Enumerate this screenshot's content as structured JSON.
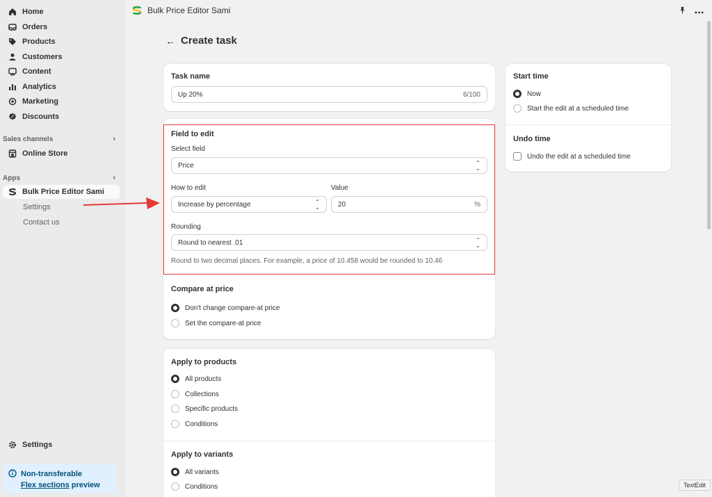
{
  "sidebar": {
    "items": [
      {
        "label": "Home",
        "icon": "home-icon"
      },
      {
        "label": "Orders",
        "icon": "inbox-icon"
      },
      {
        "label": "Products",
        "icon": "tag-icon"
      },
      {
        "label": "Customers",
        "icon": "person-icon"
      },
      {
        "label": "Content",
        "icon": "content-icon"
      },
      {
        "label": "Analytics",
        "icon": "bar-chart-icon"
      },
      {
        "label": "Marketing",
        "icon": "target-icon"
      },
      {
        "label": "Discounts",
        "icon": "discount-icon"
      }
    ],
    "sales_channels_title": "Sales channels",
    "online_store_label": "Online Store",
    "apps_title": "Apps",
    "app_label": "Bulk Price Editor Sami",
    "app_sub_items": [
      "Settings",
      "Contact us"
    ],
    "settings_label": "Settings",
    "notice": {
      "line1": "Non-transferable",
      "link": "Flex sections",
      "line2_suffix": "preview"
    }
  },
  "topbar": {
    "app_title": "Bulk Price Editor Sami"
  },
  "page": {
    "title": "Create task"
  },
  "task_name": {
    "label": "Task name",
    "value": "Up 20%",
    "counter": "6/100"
  },
  "field_to_edit": {
    "title": "Field to edit",
    "select_field_label": "Select field",
    "select_field_value": "Price",
    "how_to_edit_label": "How to edit",
    "how_to_edit_value": "Increase by percentage",
    "value_label": "Value",
    "value": "20",
    "value_suffix": "%",
    "rounding_label": "Rounding",
    "rounding_value": "Round to nearest .01",
    "rounding_help": "Round to two decimal places. For example, a price of 10.458 would be rounded to 10.46"
  },
  "compare_at_price": {
    "title": "Compare at price",
    "options": [
      "Don't change compare-at price",
      "Set the compare-at price"
    ],
    "selected": 0
  },
  "apply_to_products": {
    "title": "Apply to products",
    "options": [
      "All products",
      "Collections",
      "Specific products",
      "Conditions"
    ],
    "selected": 0
  },
  "apply_to_variants": {
    "title": "Apply to variants",
    "options": [
      "All variants",
      "Conditions"
    ],
    "selected": 0
  },
  "start_time": {
    "title": "Start time",
    "options": [
      "Now",
      "Start the edit at a scheduled time"
    ],
    "selected": 0
  },
  "undo_time": {
    "title": "Undo time",
    "checkbox_label": "Undo the edit at a scheduled time",
    "checked": false
  },
  "tooltip": {
    "text": "TextEdit"
  },
  "colors": {
    "highlight": "#e53935",
    "arrow": "#e53935",
    "notice_bg": "#e0f0ff"
  }
}
